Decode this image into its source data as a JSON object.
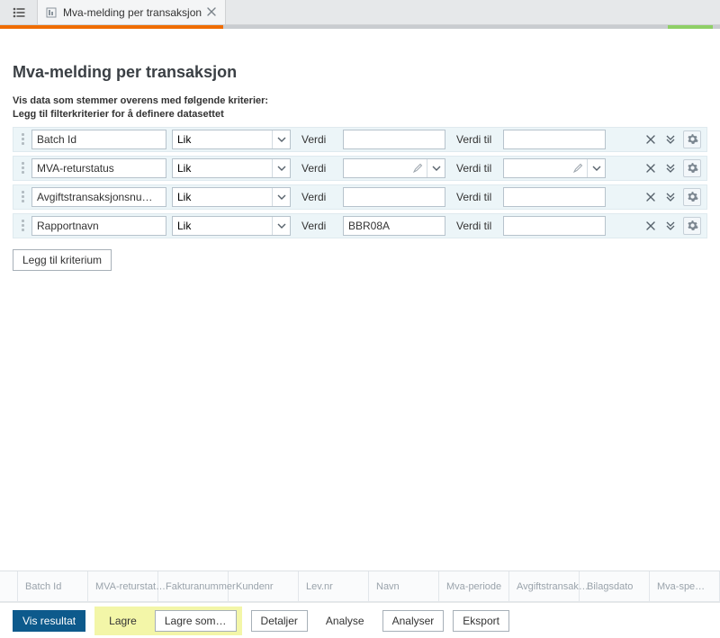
{
  "tabs": {
    "active": {
      "label": "Mva-melding per transaksjon"
    }
  },
  "page": {
    "title": "Mva-melding per transaksjon",
    "subtitle_line1": "Vis data som stemmer overens med følgende kriterier:",
    "subtitle_line2": "Legg til filterkriterier for å definere datasettet"
  },
  "filters": [
    {
      "field": "Batch Id",
      "operator": "Lik",
      "value": "",
      "value_to": "",
      "has_pencil": false
    },
    {
      "field": "MVA-returstatus",
      "operator": "Lik",
      "value": "",
      "value_to": "",
      "has_pencil": true
    },
    {
      "field": "Avgiftstransaksjonsnu…",
      "operator": "Lik",
      "value": "",
      "value_to": "",
      "has_pencil": false
    },
    {
      "field": "Rapportnavn",
      "operator": "Lik",
      "value": "BBR08A",
      "value_to": "",
      "has_pencil": false
    }
  ],
  "labels": {
    "verdi": "Verdi",
    "verdi_til": "Verdi til",
    "add_criterion": "Legg til kriterium"
  },
  "grid": {
    "columns": [
      "Batch Id",
      "MVA-returstat…",
      "Fakturanummer",
      "Kundenr",
      "Lev.nr",
      "Navn",
      "Mva-periode",
      "Avgiftstransak…",
      "Bilagsdato",
      "Mva-spe…"
    ]
  },
  "actions": {
    "show_results": "Vis resultat",
    "save": "Lagre",
    "save_as": "Lagre som…",
    "details": "Detaljer",
    "analyze": "Analyse",
    "analyser": "Analyser",
    "export": "Eksport"
  }
}
